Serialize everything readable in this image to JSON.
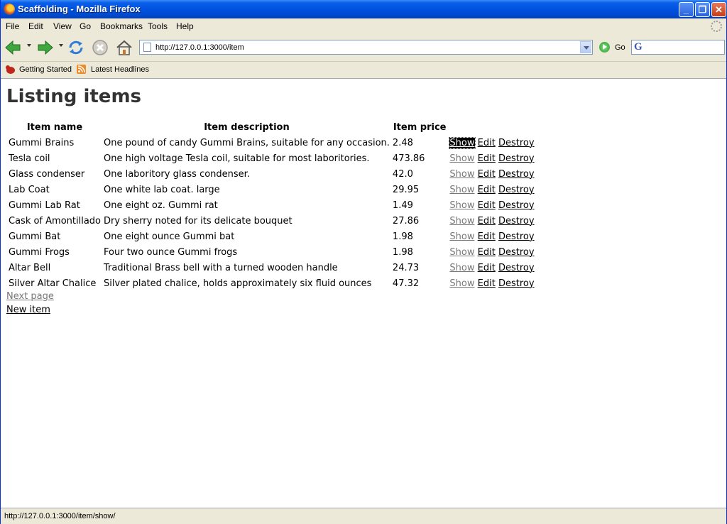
{
  "window": {
    "title": "Scaffolding - Mozilla Firefox"
  },
  "menu": [
    "File",
    "Edit",
    "View",
    "Go",
    "Bookmarks",
    "Tools",
    "Help"
  ],
  "nav": {
    "url": "http://127.0.0.1:3000/item",
    "go_label": "Go",
    "search_value": ""
  },
  "bookmarks": [
    "Getting Started",
    "Latest Headlines"
  ],
  "page": {
    "heading": "Listing items",
    "columns": [
      "Item name",
      "Item description",
      "Item price"
    ],
    "rows": [
      {
        "name": "Gummi Brains",
        "description": "One pound of candy Gummi Brains, suitable for any occasion.",
        "price": "2.48"
      },
      {
        "name": "Tesla coil",
        "description": "One high voltage Tesla coil, suitable for most laboritories.",
        "price": "473.86"
      },
      {
        "name": "Glass condenser",
        "description": "One laboritory glass condenser.",
        "price": "42.0"
      },
      {
        "name": "Lab Coat",
        "description": "One white lab coat. large",
        "price": "29.95"
      },
      {
        "name": "Gummi Lab Rat",
        "description": "One eight oz. Gummi rat",
        "price": "1.49"
      },
      {
        "name": "Cask of Amontillado",
        "description": "Dry sherry noted for its delicate bouquet",
        "price": "27.86"
      },
      {
        "name": "Gummi Bat",
        "description": "One eight ounce Gummi bat",
        "price": "1.98"
      },
      {
        "name": "Gummi Frogs",
        "description": "Four two ounce Gummi frogs",
        "price": "1.98"
      },
      {
        "name": "Altar Bell",
        "description": "Traditional Brass bell with a turned wooden handle",
        "price": "24.73"
      },
      {
        "name": "Silver Altar Chalice",
        "description": "Silver plated chalice, holds approximately six fluid ounces",
        "price": "47.32"
      }
    ],
    "actions": {
      "show": "Show",
      "edit": "Edit",
      "destroy": "Destroy"
    },
    "next_page": "Next page",
    "new_item": "New item"
  },
  "status": {
    "text": "http://127.0.0.1:3000/item/show/"
  }
}
